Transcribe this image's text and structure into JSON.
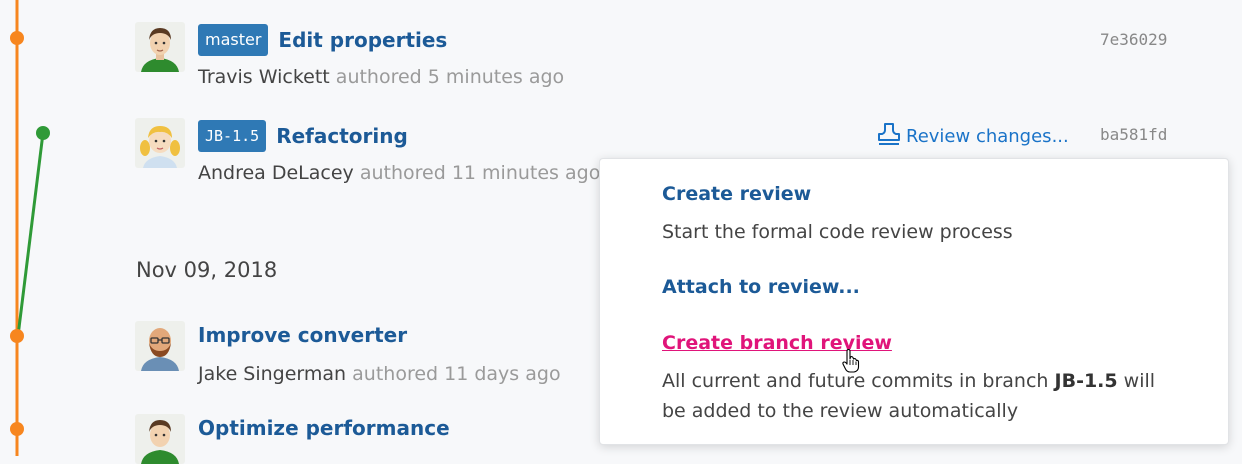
{
  "colors": {
    "main_branch": "#f7861f",
    "side_branch": "#2f9a37",
    "link": "#1c5a97",
    "badge": "#2f79b5",
    "hover": "#e0147a"
  },
  "commits": [
    {
      "badge": "master",
      "title": "Edit properties",
      "author": "Travis Wickett",
      "meta": "authored 5 minutes ago",
      "hash": "7e36029",
      "avatar": "man-green-shirt"
    },
    {
      "badge": "JB-1.5",
      "title": "Refactoring",
      "author": "Andrea DeLacey",
      "meta": "authored 11 minutes ago",
      "hash": "ba581fd",
      "avatar": "girl-pigtails",
      "review_action": "Review changes..."
    },
    {
      "title": "Improve converter",
      "author": "Jake Singerman",
      "meta": "authored 11 days ago",
      "avatar": "bald-man-beard"
    },
    {
      "title": "Optimize performance",
      "avatar": "man-green-shirt"
    }
  ],
  "date_heading": "Nov 09, 2018",
  "review_menu": {
    "create_review": {
      "label": "Create review",
      "desc": "Start the formal code review process"
    },
    "attach_review": {
      "label": "Attach to review..."
    },
    "branch_review": {
      "label": "Create branch review",
      "desc_pre": "All current and future commits in branch ",
      "desc_branch": "JB-1.5",
      "desc_post": " will be added to the review automatically"
    }
  },
  "icons": {
    "review": "review-stamp-icon",
    "cursor": "hand-pointer-icon"
  }
}
